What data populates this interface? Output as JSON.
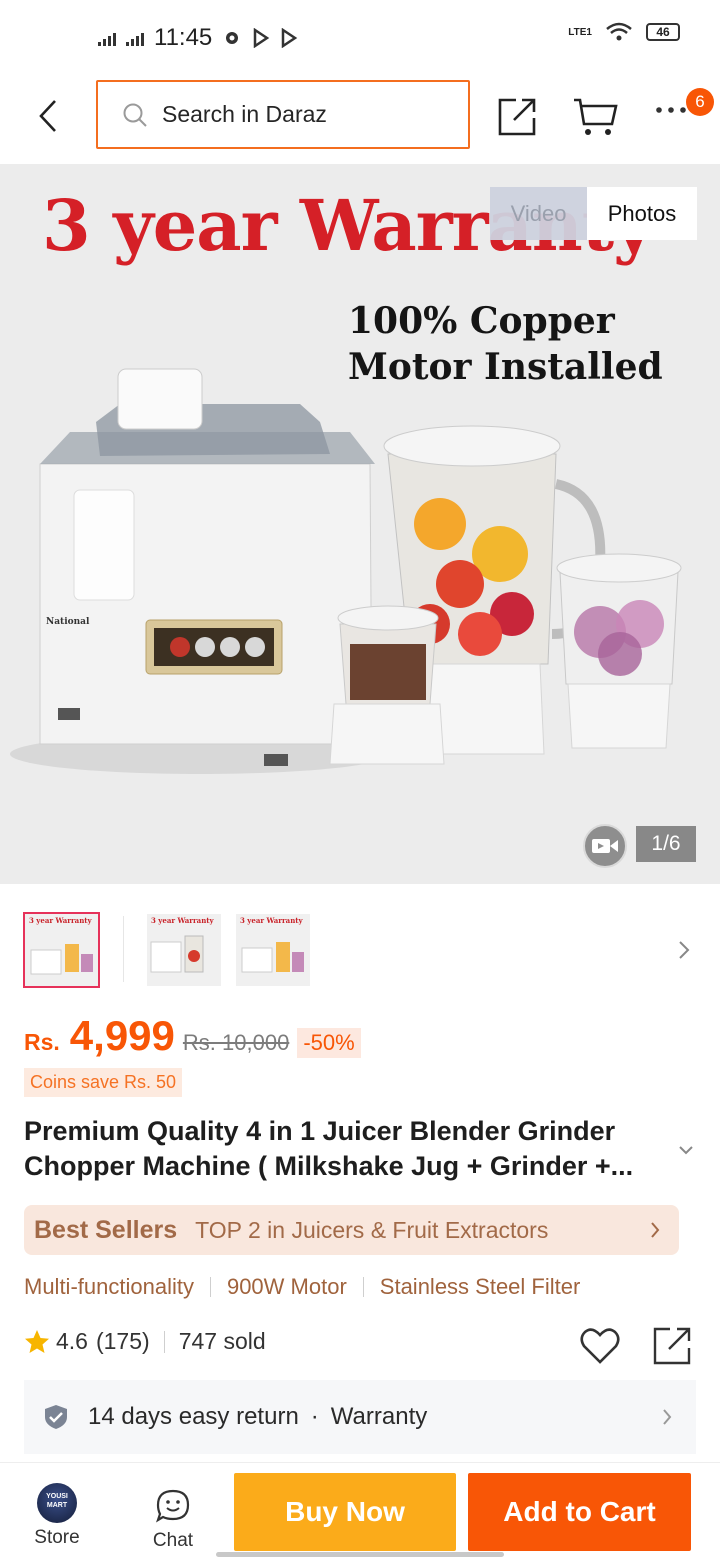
{
  "status_bar": {
    "time": "11:45",
    "network_label": "LTE1",
    "battery": "46"
  },
  "header": {
    "search_placeholder": "Search in Daraz",
    "cart_badge": "6"
  },
  "gallery": {
    "banner_text": "3 year Warranty",
    "sub_banner_line1": "100% Copper",
    "sub_banner_line2": "Motor Installed",
    "brand_on_product": "National",
    "tabs": [
      "Video",
      "Photos"
    ],
    "active_tab": "Photos",
    "counter": "1/6",
    "thumbnails": [
      {
        "caption": "3 year Warranty",
        "active": true
      },
      {
        "caption": "3 year Warranty",
        "active": false
      },
      {
        "caption": "3 year Warranty",
        "active": false
      }
    ]
  },
  "price": {
    "currency": "Rs.",
    "current": "4,999",
    "original": "Rs. 10,000",
    "discount": "-50%",
    "coins": "Coins save Rs. 50"
  },
  "product": {
    "title": "Premium Quality 4 in 1 Juicer Blender Grinder Chopper Machine ( Milkshake Jug + Grinder +..."
  },
  "best_sellers": {
    "label": "Best Sellers",
    "text": "TOP 2 in Juicers & Fruit Extractors"
  },
  "features": [
    "Multi-functionality",
    "900W Motor",
    "Stainless Steel Filter"
  ],
  "rating": {
    "score": "4.6",
    "count": "(175)",
    "sold": "747 sold"
  },
  "service": {
    "return": "14 days easy return",
    "separator": "·",
    "warranty": "Warranty"
  },
  "bottom_bar": {
    "store_label": "Store",
    "store_logo_text": "YOUSI MART",
    "chat_label": "Chat",
    "buy_now": "Buy Now",
    "add_to_cart": "Add to Cart"
  },
  "colors": {
    "brand_orange": "#f85606",
    "buy_now_yellow": "#fbab1a",
    "banner_red": "#d52027",
    "star": "#f7b500"
  },
  "icons": [
    "back-chevron-icon",
    "search-icon",
    "share-icon",
    "cart-icon",
    "more-icon",
    "video-camera-icon",
    "chevron-right-icon",
    "chevron-down-icon",
    "star-icon",
    "heart-icon",
    "shield-check-icon",
    "chat-icon",
    "store-logo"
  ]
}
